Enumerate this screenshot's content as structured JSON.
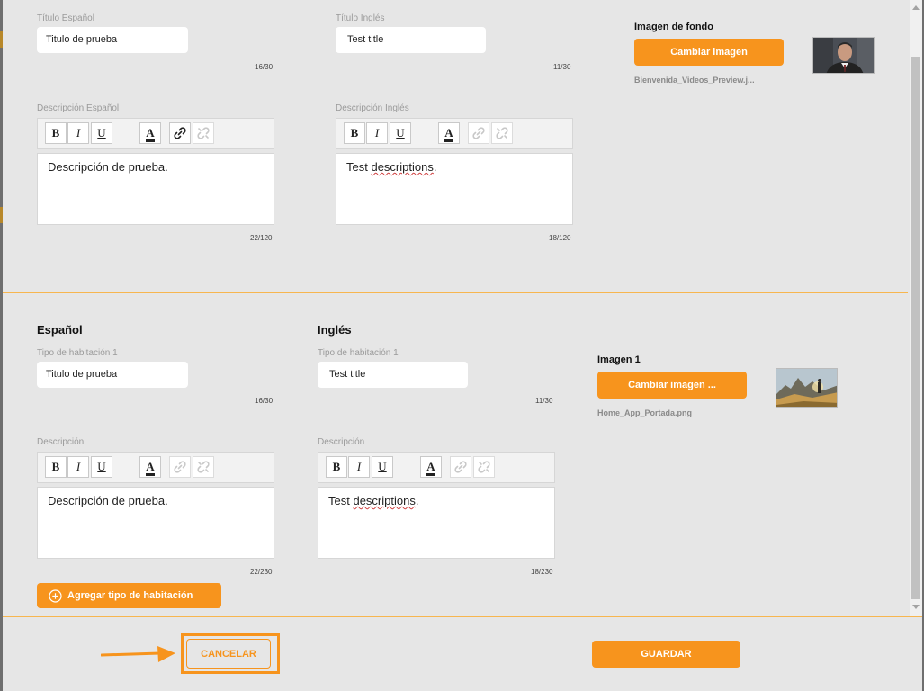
{
  "section1": {
    "title_es_label": "Título Español",
    "title_es_value": "Titulo de prueba",
    "title_es_counter": "16/30",
    "title_en_label": "Título Inglés",
    "title_en_value": "Test title",
    "title_en_counter": "11/30",
    "desc_es_label": "Descripción Español",
    "desc_es_text": "Descripción de prueba.",
    "desc_es_counter": "22/120",
    "desc_en_label": "Descripción Inglés",
    "desc_en_text_a": "Test ",
    "desc_en_text_b": "descriptions",
    "desc_en_text_c": ".",
    "desc_en_counter": "18/120",
    "bg_label": "Imagen de fondo",
    "bg_button": "Cambiar imagen",
    "bg_filename": "Bienvenida_Videos_Preview.j..."
  },
  "section2": {
    "es_heading": "Español",
    "en_heading": "Inglés",
    "room_es_label": "Tipo de habitación 1",
    "room_es_value": "Titulo de prueba",
    "room_es_counter": "16/30",
    "room_en_label": "Tipo de habitación 1",
    "room_en_value": "Test title",
    "room_en_counter": "11/30",
    "desc_es_label": "Descripción",
    "desc_es_text": "Descripción de prueba.",
    "desc_es_counter": "22/230",
    "desc_en_label": "Descripción",
    "desc_en_text_a": "Test ",
    "desc_en_text_b": "descriptions",
    "desc_en_text_c": ".",
    "desc_en_counter": "18/230",
    "image_label": "Imagen 1",
    "image_button": "Cambiar imagen ...",
    "image_filename": "Home_App_Portada.png",
    "add_room_button": "Agregar tipo de habitación"
  },
  "toolbar": {
    "bold": "B",
    "italic": "I",
    "underline": "U",
    "font_color": "A",
    "icons": [
      "link-icon",
      "unlink-icon"
    ]
  },
  "footer": {
    "cancel": "CANCELAR",
    "save": "GUARDAR"
  },
  "colors": {
    "accent": "#f7941d",
    "divider": "#f7b64f",
    "background": "#e6e6e6"
  }
}
